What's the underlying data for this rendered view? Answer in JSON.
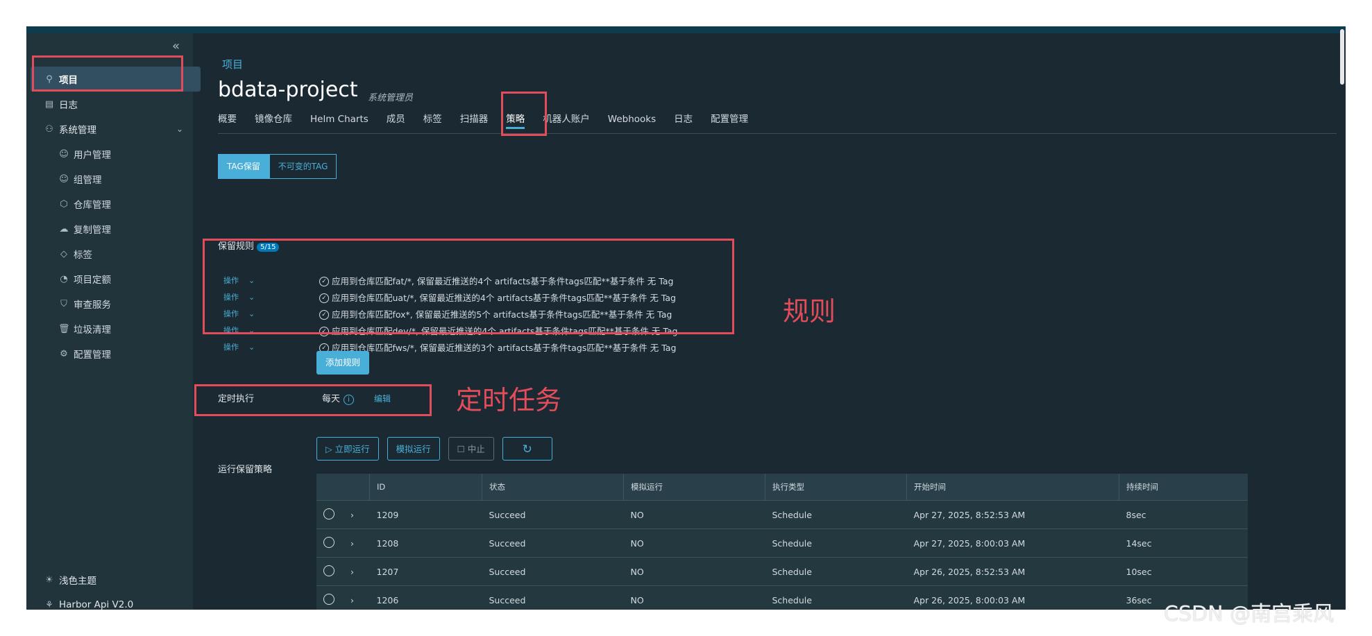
{
  "sidebar": {
    "collapse_icon": "«",
    "items": [
      {
        "label": "项目",
        "icon": "project-icon"
      },
      {
        "label": "日志",
        "icon": "log-icon"
      },
      {
        "label": "系统管理",
        "icon": "admin-icon"
      }
    ],
    "sub_items": [
      {
        "label": "用户管理"
      },
      {
        "label": "组管理"
      },
      {
        "label": "仓库管理"
      },
      {
        "label": "复制管理"
      },
      {
        "label": "标签"
      },
      {
        "label": "项目定额"
      },
      {
        "label": "审查服务"
      },
      {
        "label": "垃圾清理"
      },
      {
        "label": "配置管理"
      }
    ],
    "bottom": [
      {
        "label": "浅色主题"
      },
      {
        "label": "Harbor Api V2.0"
      }
    ]
  },
  "breadcrumb": "项目",
  "project": {
    "name": "bdata-project",
    "role": "系统管理员"
  },
  "tabs": [
    "概要",
    "镜像仓库",
    "Helm Charts",
    "成员",
    "标签",
    "扫描器",
    "策略",
    "机器人账户",
    "Webhooks",
    "日志",
    "配置管理"
  ],
  "active_tab": "策略",
  "segment": {
    "tag_retention": "TAG保留",
    "immutable_tag": "不可变的TAG"
  },
  "retention": {
    "label": "保留规则",
    "count_badge": "5/15",
    "rules": [
      {
        "op": "操作",
        "text": "应用到仓库匹配fat/*, 保留最近推送的4个 artifacts基于条件tags匹配**基于条件 无 Tag"
      },
      {
        "op": "操作",
        "text": "应用到仓库匹配uat/*, 保留最近推送的4个 artifacts基于条件tags匹配**基于条件 无 Tag"
      },
      {
        "op": "操作",
        "text": "应用到仓库匹配fox*, 保留最近推送的5个 artifacts基于条件tags匹配**基于条件 无 Tag"
      },
      {
        "op": "操作",
        "text": "应用到仓库匹配dev/*, 保留最近推送的4个 artifacts基于条件tags匹配**基于条件 无 Tag"
      },
      {
        "op": "操作",
        "text": "应用到仓库匹配fws/*, 保留最近推送的3个 artifacts基于条件tags匹配**基于条件 无 Tag"
      }
    ],
    "add_rule": "添加规则"
  },
  "schedule": {
    "label": "定时执行",
    "value": "每天",
    "edit": "编辑"
  },
  "run": {
    "label": "运行保留策略",
    "run_now": "▷ 立即运行",
    "dry_run": "模拟运行",
    "abort": "☐ 中止",
    "refresh": "↻"
  },
  "table": {
    "headers": [
      "ID",
      "状态",
      "模拟运行",
      "执行类型",
      "开始时间",
      "持续时间"
    ],
    "rows": [
      {
        "id": "1209",
        "status": "Succeed",
        "dry": "NO",
        "type": "Schedule",
        "start": "Apr 27, 2025, 8:52:53 AM",
        "duration": "8sec"
      },
      {
        "id": "1208",
        "status": "Succeed",
        "dry": "NO",
        "type": "Schedule",
        "start": "Apr 27, 2025, 8:00:03 AM",
        "duration": "14sec"
      },
      {
        "id": "1207",
        "status": "Succeed",
        "dry": "NO",
        "type": "Schedule",
        "start": "Apr 26, 2025, 8:52:53 AM",
        "duration": "10sec"
      },
      {
        "id": "1206",
        "status": "Succeed",
        "dry": "NO",
        "type": "Schedule",
        "start": "Apr 26, 2025, 8:00:03 AM",
        "duration": "36sec"
      }
    ]
  },
  "annotations": {
    "rules": "规则",
    "cron": "定时任务"
  },
  "watermark": "CSDN @南宫乘风",
  "colors": {
    "accent": "#49afd9",
    "annotation": "#e34c5a",
    "bg": "#1b2a32",
    "sidebar": "#21333b"
  }
}
